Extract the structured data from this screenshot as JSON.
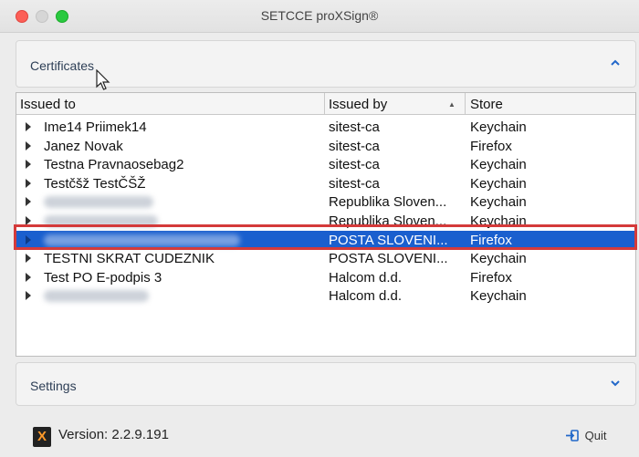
{
  "window": {
    "title": "SETCCE proXSign®"
  },
  "certificates_panel": {
    "label": "Certificates",
    "chevron": "chevron-up-icon"
  },
  "table": {
    "columns": [
      "Issued to",
      "Issued by",
      "Store"
    ],
    "sort": {
      "column": "Issued by",
      "direction": "ascending"
    },
    "rows": [
      {
        "issued_to": "Ime14 Priimek14",
        "issued_by": "sitest-ca",
        "store": "Keychain"
      },
      {
        "issued_to": "Janez Novak",
        "issued_by": "sitest-ca",
        "store": "Firefox"
      },
      {
        "issued_to": "Testna Pravnaosebag2",
        "issued_by": "sitest-ca",
        "store": "Keychain"
      },
      {
        "issued_to": "Testčšž TestČŠŽ",
        "issued_by": "sitest-ca",
        "store": "Keychain"
      },
      {
        "issued_to": "",
        "issued_by": "Republika Sloven...",
        "store": "Keychain"
      },
      {
        "issued_to": "",
        "issued_by": "Republika Sloven...",
        "store": "Keychain"
      },
      {
        "issued_to": "",
        "issued_by": "POSTA SLOVENI...",
        "store": "Firefox"
      },
      {
        "issued_to": "TESTNI SKRAT CUDEZNIK",
        "issued_by": "POSTA SLOVENI...",
        "store": "Keychain"
      },
      {
        "issued_to": "Test PO E-podpis 3",
        "issued_by": "Halcom d.d.",
        "store": "Firefox"
      },
      {
        "issued_to": "",
        "issued_by": "Halcom d.d.",
        "store": "Keychain"
      }
    ],
    "selected_row_index": 6
  },
  "settings_panel": {
    "label": "Settings",
    "chevron": "chevron-down-icon"
  },
  "footer": {
    "version": "Version: 2.2.9.191",
    "quit_label": "Quit",
    "logo_letter": "X"
  },
  "colors": {
    "selection": "#1a5fce",
    "highlight_outline": "#d43a3a",
    "accent": "#2268c9"
  }
}
